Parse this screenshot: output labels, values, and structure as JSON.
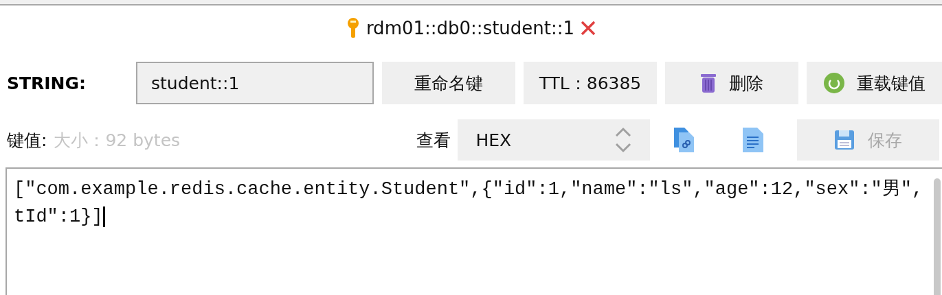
{
  "tab": {
    "title": "rdm01::db0::student::1"
  },
  "key_row": {
    "type_label": "STRING:",
    "key_name": "student::1",
    "buttons": [
      {
        "kind": "rename",
        "label": "重命名键"
      },
      {
        "kind": "ttl",
        "label": "TTL：86385"
      },
      {
        "kind": "delete",
        "label": "删除"
      },
      {
        "kind": "reload",
        "label": "重载键值"
      }
    ]
  },
  "value_row": {
    "value_label": "键值:",
    "size": "大小：92 bytes",
    "view_label": "查看",
    "format": "HEX",
    "tools": [
      {
        "kind": "copy"
      },
      {
        "kind": "format"
      }
    ],
    "save": {
      "label": "保存",
      "disabled": true
    }
  },
  "editor": {
    "lines": [
      "[\"com.example.redis.cache.entity.Student\",{\"id\":1,\"name\":\"ls\",\"age\":12,\"sex\":\"男\",",
      "tId\":1}]"
    ]
  }
}
